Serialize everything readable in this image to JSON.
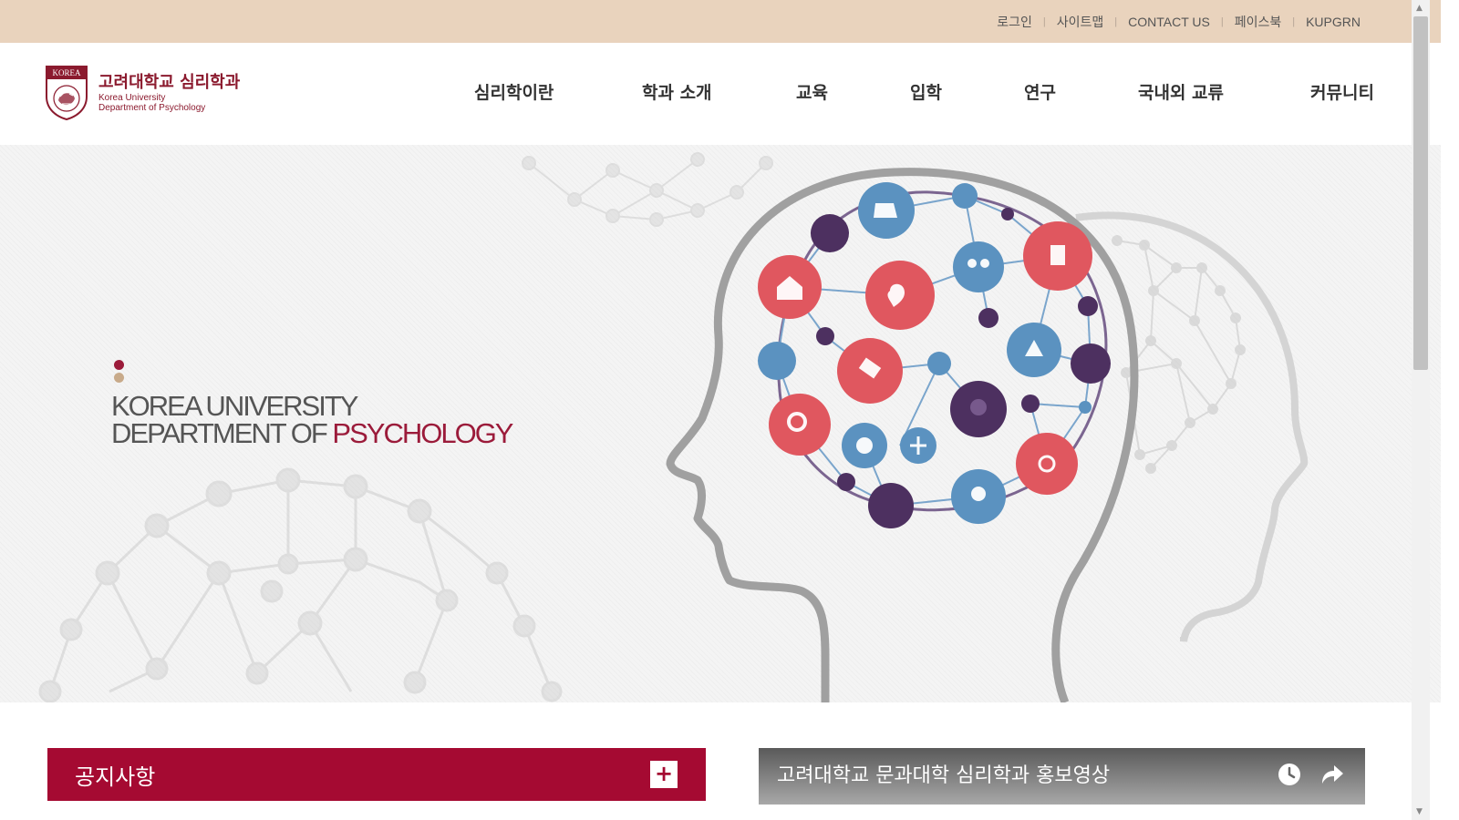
{
  "colors": {
    "top_bar": "#e9d3bd",
    "brand": "#8b1a2e",
    "notice_bg": "#a50a32",
    "circle_red": "#e0575f",
    "circle_blue": "#5b92c0",
    "circle_purple": "#4d3060"
  },
  "top_links": [
    "로그인",
    "사이트맵",
    "CONTACT US",
    "페이스북",
    "KUPGRN"
  ],
  "logo": {
    "name_ko": "고려대학교 심리학과",
    "name_en_1": "Korea University",
    "name_en_2": "Department of Psychology",
    "emblem_text": "KOREA"
  },
  "nav": [
    "심리학이란",
    "학과 소개",
    "교육",
    "입학",
    "연구",
    "국내외 교류",
    "커뮤니티"
  ],
  "hero": {
    "line1": "KOREA UNIVERSITY",
    "line2_prefix": "DEPARTMENT OF ",
    "line2_accent": "PSYCHOLOGY"
  },
  "notice": {
    "title": "공지사항",
    "more_icon": "plus-icon"
  },
  "video": {
    "title": "고려대학교 문과대학 심리학과 홍보영상",
    "icons": [
      "clock-icon",
      "share-icon"
    ]
  }
}
